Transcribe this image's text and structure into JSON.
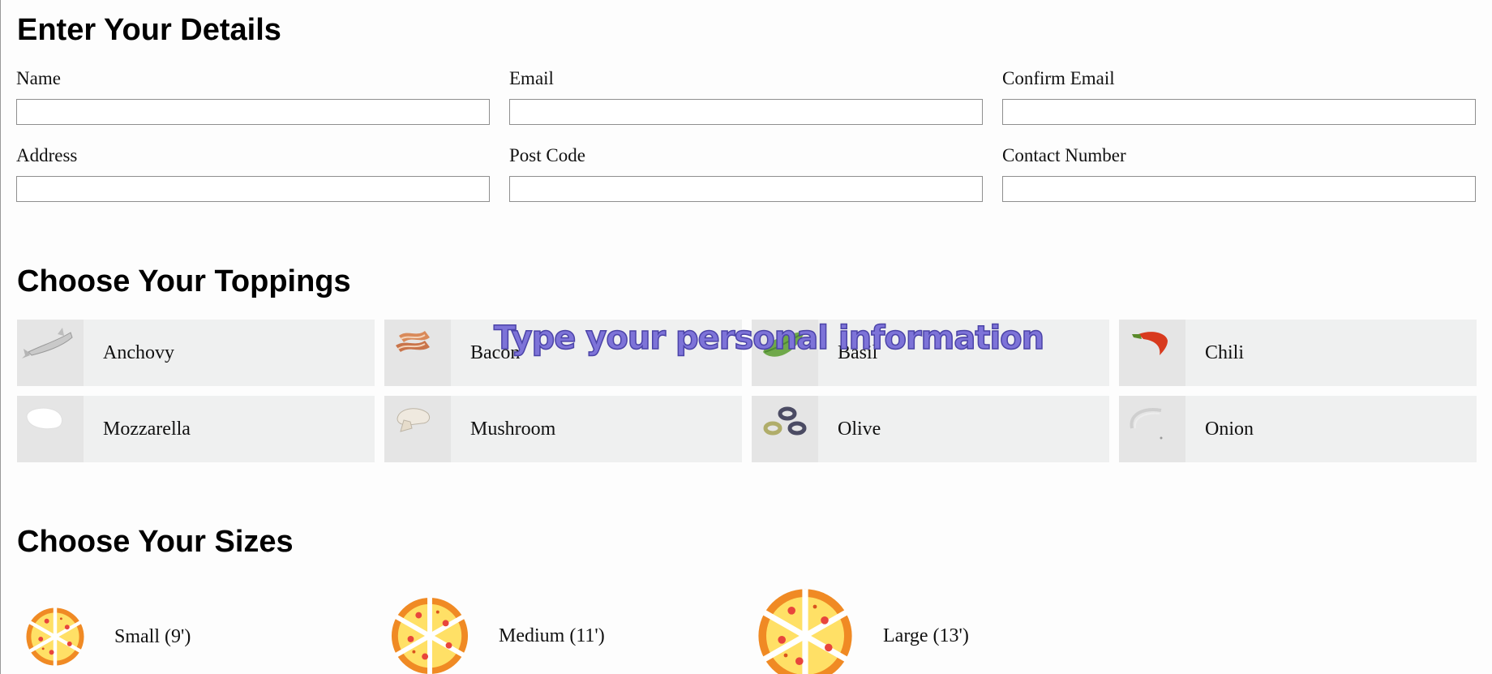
{
  "details": {
    "title": "Enter Your Details",
    "fields": [
      {
        "label": "Name",
        "value": "",
        "placeholder": ""
      },
      {
        "label": "Email",
        "value": "",
        "placeholder": ""
      },
      {
        "label": "Confirm Email",
        "value": "",
        "placeholder": ""
      },
      {
        "label": "Address",
        "value": "",
        "placeholder": ""
      },
      {
        "label": "Post Code",
        "value": "",
        "placeholder": ""
      },
      {
        "label": "Contact Number",
        "value": "",
        "placeholder": ""
      }
    ]
  },
  "toppings": {
    "title": "Choose Your Toppings",
    "items": [
      {
        "label": "Anchovy",
        "icon": "anchovy-icon"
      },
      {
        "label": "Bacon",
        "icon": "bacon-icon"
      },
      {
        "label": "Basil",
        "icon": "basil-icon"
      },
      {
        "label": "Chili",
        "icon": "chili-icon"
      },
      {
        "label": "Mozzarella",
        "icon": "mozzarella-icon"
      },
      {
        "label": "Mushroom",
        "icon": "mushroom-icon"
      },
      {
        "label": "Olive",
        "icon": "olive-icon"
      },
      {
        "label": "Onion",
        "icon": "onion-icon"
      }
    ]
  },
  "sizes": {
    "title": "Choose Your Sizes",
    "items": [
      {
        "label": "Small (9')",
        "icon": "pizza-icon"
      },
      {
        "label": "Medium (11')",
        "icon": "pizza-icon"
      },
      {
        "label": "Large (13')",
        "icon": "pizza-icon"
      }
    ]
  },
  "overlay_caption": "Type your personal information",
  "colors": {
    "tile_bg": "#eff0f0",
    "tile_icon_bg": "#e5e5e5",
    "caption": "#7d73d8",
    "pizza_crust": "#f08a24",
    "pizza_cheese": "#ffe066",
    "pizza_pepperoni": "#e8453c"
  }
}
